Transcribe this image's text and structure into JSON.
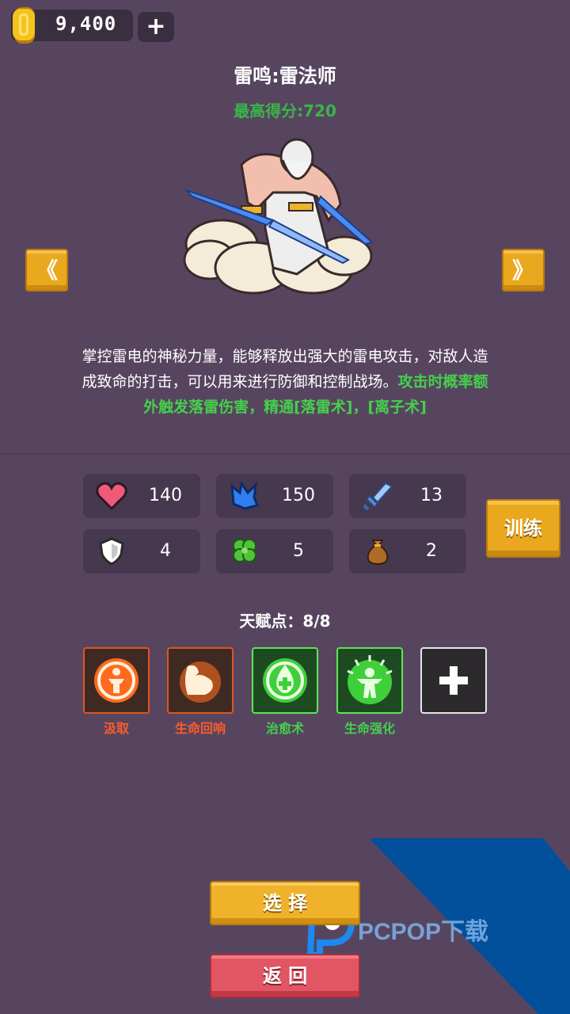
{
  "currency": {
    "amount": "9,400",
    "add_label": "+",
    "icon": "gold-coin-icon"
  },
  "hero": {
    "title": "雷鸣:雷法师",
    "best_score": "最高得分:720",
    "prev_label": "《",
    "next_label": "》",
    "description_main": "掌控雷电的神秘力量，能够释放出强大的雷电攻击，对敌人造成致命的打击，可以用来进行防御和控制战场。",
    "description_highlight": "攻击时概率额外触发落雷伤害，精通[落雷术]，[离子术]"
  },
  "stats": [
    {
      "icon": "heart-icon",
      "value": "140"
    },
    {
      "icon": "blue-crystal-icon",
      "value": "150"
    },
    {
      "icon": "sword-icon",
      "value": "13"
    },
    {
      "icon": "shield-icon",
      "value": "4"
    },
    {
      "icon": "clover-icon",
      "value": "5"
    },
    {
      "icon": "money-bag-icon",
      "value": "2"
    }
  ],
  "train_label": "训练",
  "talents": {
    "label": "天赋点：8/8",
    "items": [
      {
        "name": "汲取",
        "icon": "absorb-icon",
        "color": "#ff5a2a"
      },
      {
        "name": "生命回响",
        "icon": "flexed-arm-icon",
        "color": "#ff5a2a"
      },
      {
        "name": "治愈术",
        "icon": "healing-drop-icon",
        "color": "#44d04a"
      },
      {
        "name": "生命强化",
        "icon": "life-boost-icon",
        "color": "#44d04a"
      }
    ],
    "add_label": "+"
  },
  "buttons": {
    "select_label": "选 择",
    "back_label": "返 回"
  },
  "watermark": {
    "text": "PCPOP下载"
  },
  "colors": {
    "background": "#574560",
    "gold_button": "#e9a81e",
    "red_button": "#e25664",
    "highlight_green": "#44d04a",
    "talent_orange": "#ff5a2a"
  }
}
